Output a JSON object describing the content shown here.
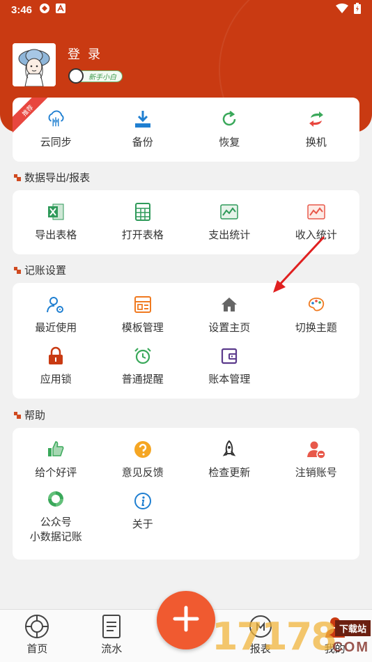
{
  "status_bar": {
    "time": "3:46"
  },
  "header": {
    "login_label": "登 录",
    "level_badge": "新手小白"
  },
  "top_actions": {
    "ribbon": "推荐",
    "items": [
      {
        "label": "云同步",
        "icon": "cloud-sync-icon",
        "color": "#1f7fd1"
      },
      {
        "label": "备份",
        "icon": "download-icon",
        "color": "#1f7fd1"
      },
      {
        "label": "恢复",
        "icon": "refresh-icon",
        "color": "#3aa85a"
      },
      {
        "label": "换机",
        "icon": "swap-icon",
        "color": "#e8473f"
      }
    ]
  },
  "sections": [
    {
      "title": "数据导出/报表",
      "items": [
        {
          "label": "导出表格",
          "icon": "excel-icon"
        },
        {
          "label": "打开表格",
          "icon": "spreadsheet-icon"
        },
        {
          "label": "支出统计",
          "icon": "expense-chart-icon"
        },
        {
          "label": "收入统计",
          "icon": "income-chart-icon"
        }
      ]
    },
    {
      "title": "记账设置",
      "items": [
        {
          "label": "最近使用",
          "icon": "user-gear-icon"
        },
        {
          "label": "模板管理",
          "icon": "template-icon"
        },
        {
          "label": "设置主页",
          "icon": "home-icon"
        },
        {
          "label": "切换主题",
          "icon": "palette-icon"
        },
        {
          "label": "应用锁",
          "icon": "lock-icon"
        },
        {
          "label": "普通提醒",
          "icon": "alarm-clock-icon"
        },
        {
          "label": "账本管理",
          "icon": "wallet-icon"
        }
      ]
    },
    {
      "title": "帮助",
      "items": [
        {
          "label": "给个好评",
          "icon": "thumbs-up-icon"
        },
        {
          "label": "意见反馈",
          "icon": "question-icon"
        },
        {
          "label": "检查更新",
          "icon": "rocket-icon"
        },
        {
          "label": "注销账号",
          "icon": "user-remove-icon"
        },
        {
          "label": "公众号\n小数据记账",
          "icon": "wechat-icon"
        },
        {
          "label": "关于",
          "icon": "info-icon"
        }
      ]
    }
  ],
  "bottom_nav": [
    {
      "label": "首页",
      "icon": "home-nav-icon"
    },
    {
      "label": "流水",
      "icon": "document-icon"
    },
    {
      "label": "",
      "icon": "plus-icon"
    },
    {
      "label": "报表",
      "icon": "report-icon"
    },
    {
      "label": "我的",
      "icon": "profile-icon"
    }
  ],
  "watermark": {
    "number": "17178",
    "tag": "下载站",
    "domain": "COM"
  },
  "colors": {
    "header": "#c93a12",
    "fab": "#f05a30",
    "accent": "#d04a20"
  }
}
